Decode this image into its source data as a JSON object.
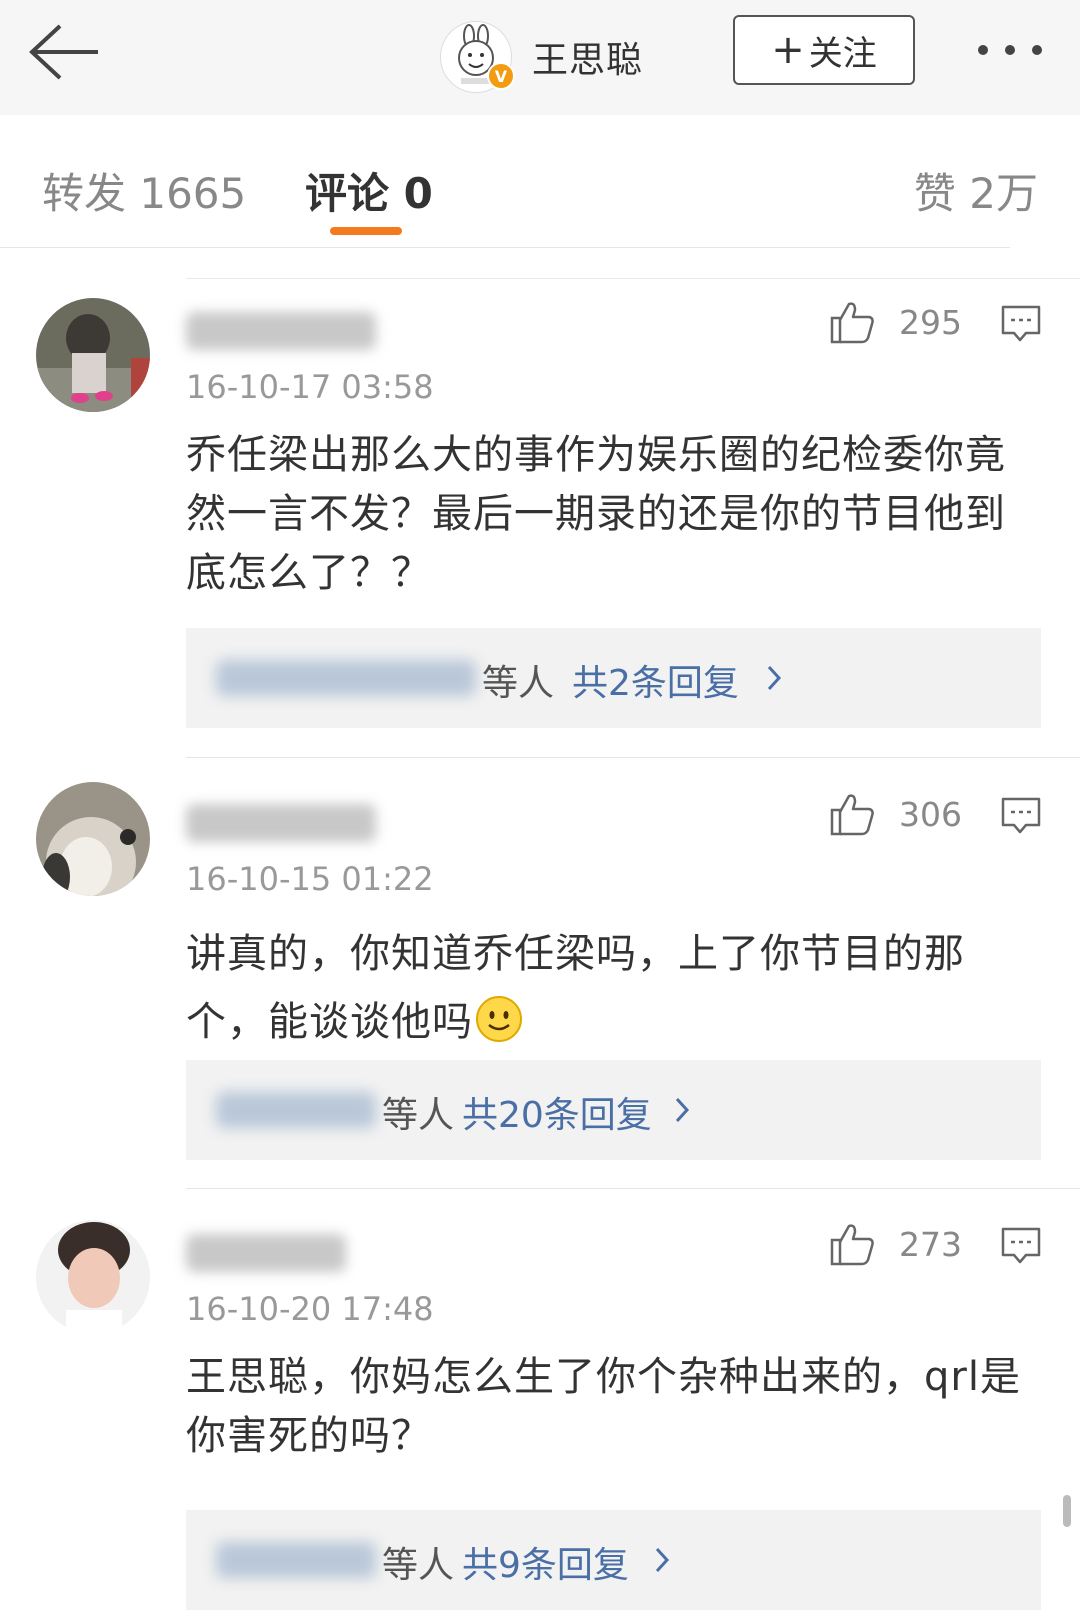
{
  "header": {
    "back_icon": "arrow-left-icon",
    "profile_name": "王思聪",
    "verify_badge": "V",
    "follow_plus": "+",
    "follow_label": "关注",
    "more_icon": "more-horizontal-icon"
  },
  "tabs": {
    "repost": "转发 1665",
    "comment": "评论 0",
    "like": "赞 2万",
    "accent_color": "#f47b1d"
  },
  "comments": [
    {
      "likes": "295",
      "time": "16-10-17 03:58",
      "text": "乔任梁出那么大的事作为娱乐圈的纪检委你竟然一言不发？最后一期录的还是你的节目他到底怎么了？？",
      "reply_suffix": "等人",
      "reply_link": "共2条回复"
    },
    {
      "likes": "306",
      "time": "16-10-15 01:22",
      "text": "讲真的，你知道乔任梁吗，上了你节目的那个，能谈谈他吗",
      "reply_suffix": "等人",
      "reply_link": "共20条回复"
    },
    {
      "likes": "273",
      "time": "16-10-20 17:48",
      "text": "王思聪，你妈怎么生了你个杂种出来的，qrl是你害死的吗？",
      "reply_suffix": "等人",
      "reply_link": "共9条回复"
    }
  ],
  "colors": {
    "link": "#4a6fa5",
    "reply_box_bg": "#f2f2f2",
    "header_bg": "#f6f6f6"
  }
}
